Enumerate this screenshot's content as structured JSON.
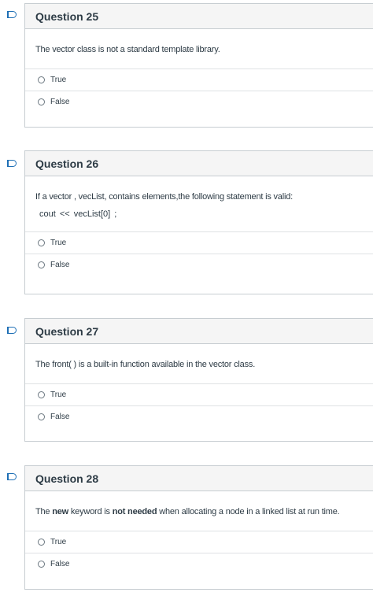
{
  "questions": [
    {
      "title": "Question 25",
      "text": "The vector class is not a standard template library.",
      "options": [
        "True",
        "False"
      ]
    },
    {
      "title": "Question 26",
      "text": "If a vector , vecList, contains elements,the following statement is valid:",
      "code": "cout <<  vecList[0] ;",
      "options": [
        "True",
        "False"
      ]
    },
    {
      "title": "Question 27",
      "text": "The front( ) is a built-in function available in the vector class.",
      "options": [
        "True",
        "False"
      ]
    },
    {
      "title": "Question 28",
      "text_parts": [
        "The ",
        "new",
        " keyword is ",
        "not needed",
        " when allocating a node in a linked list at run time."
      ],
      "options": [
        "True",
        "False"
      ]
    }
  ],
  "colors": {
    "flag": "#1e6fb5",
    "header_bg": "#f5f5f5",
    "border": "#c7cdd1"
  },
  "icons": {
    "flag": "flag-question-icon",
    "radio": "radio-button-icon"
  }
}
